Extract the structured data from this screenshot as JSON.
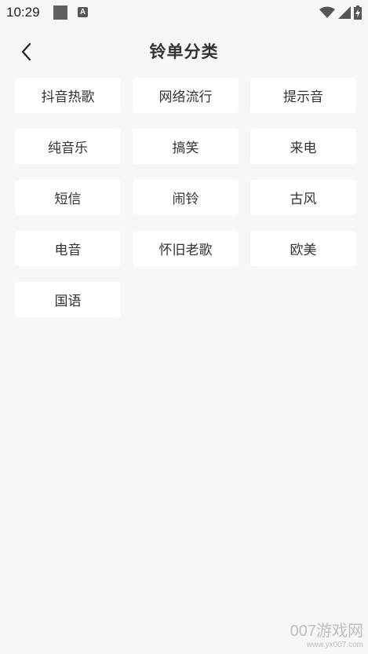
{
  "status_bar": {
    "time": "10:29",
    "notification_letter": "A"
  },
  "header": {
    "title": "铃单分类",
    "back_icon": "chevron-left-icon"
  },
  "categories": [
    "抖音热歌",
    "网络流行",
    "提示音",
    "纯音乐",
    "搞笑",
    "来电",
    "短信",
    "闹铃",
    "古风",
    "电音",
    "怀旧老歌",
    "欧美",
    "国语"
  ],
  "watermark": {
    "main": "007游戏网",
    "url": "www.yx007.com"
  },
  "colors": {
    "background": "#f6f7fa",
    "chip_background": "#ffffff",
    "text": "#333333"
  }
}
